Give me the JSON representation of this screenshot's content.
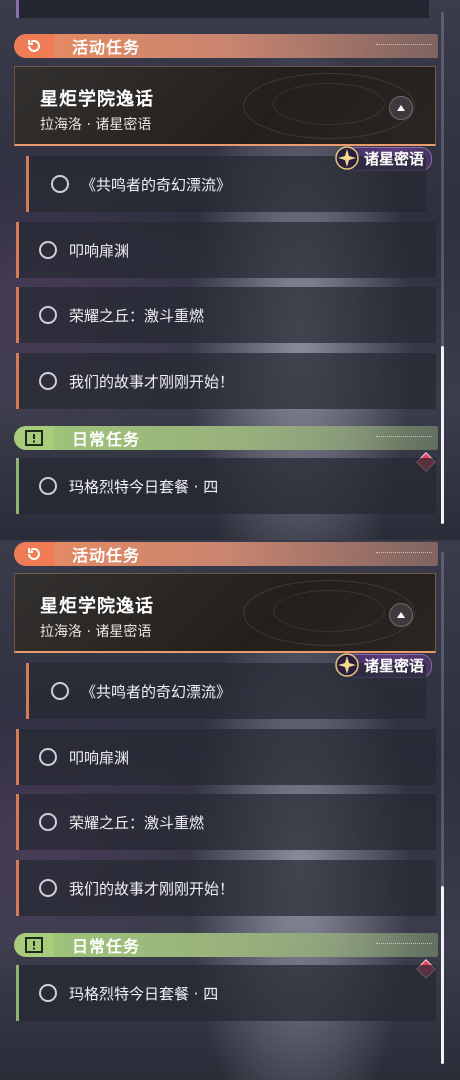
{
  "panels": [
    {
      "activity_header": {
        "title": "活动任务",
        "icon": "activity-refresh-icon",
        "accent": "#f07c55"
      },
      "event_card": {
        "title": "星炬学院逸话",
        "subtitle": "拉海洛 · 诸星密语"
      },
      "badge": {
        "label": "诸星密语",
        "icon": "star-emblem-icon"
      },
      "quests": [
        {
          "label": "《共鸣者的奇幻漂流》",
          "indented": true
        },
        {
          "label": "叩响扉渊"
        },
        {
          "label": "荣耀之丘：激斗重燃"
        },
        {
          "label": "我们的故事才刚刚开始！"
        }
      ],
      "daily_header": {
        "title": "日常任务",
        "icon": "exclamation-icon",
        "accent": "#a6cc7c"
      },
      "daily_quests": [
        {
          "label": "玛格烈特今日套餐 · 四",
          "tracked": true
        }
      ],
      "scrollbar": {
        "position_fraction": 0.64
      }
    },
    {
      "activity_header": {
        "title": "活动任务",
        "icon": "activity-refresh-icon",
        "accent": "#f07c55"
      },
      "event_card": {
        "title": "星炬学院逸话",
        "subtitle": "拉海洛 · 诸星密语"
      },
      "badge": {
        "label": "诸星密语",
        "icon": "star-emblem-icon"
      },
      "quests": [
        {
          "label": "《共鸣者的奇幻漂流》",
          "indented": true
        },
        {
          "label": "叩响扉渊"
        },
        {
          "label": "荣耀之丘：激斗重燃"
        },
        {
          "label": "我们的故事才刚刚开始！"
        }
      ],
      "daily_header": {
        "title": "日常任务",
        "icon": "exclamation-icon",
        "accent": "#a6cc7c"
      },
      "daily_quests": [
        {
          "label": "玛格烈特今日套餐 · 四",
          "tracked": true
        }
      ],
      "scrollbar": {
        "position_fraction": 0.64
      }
    }
  ]
}
